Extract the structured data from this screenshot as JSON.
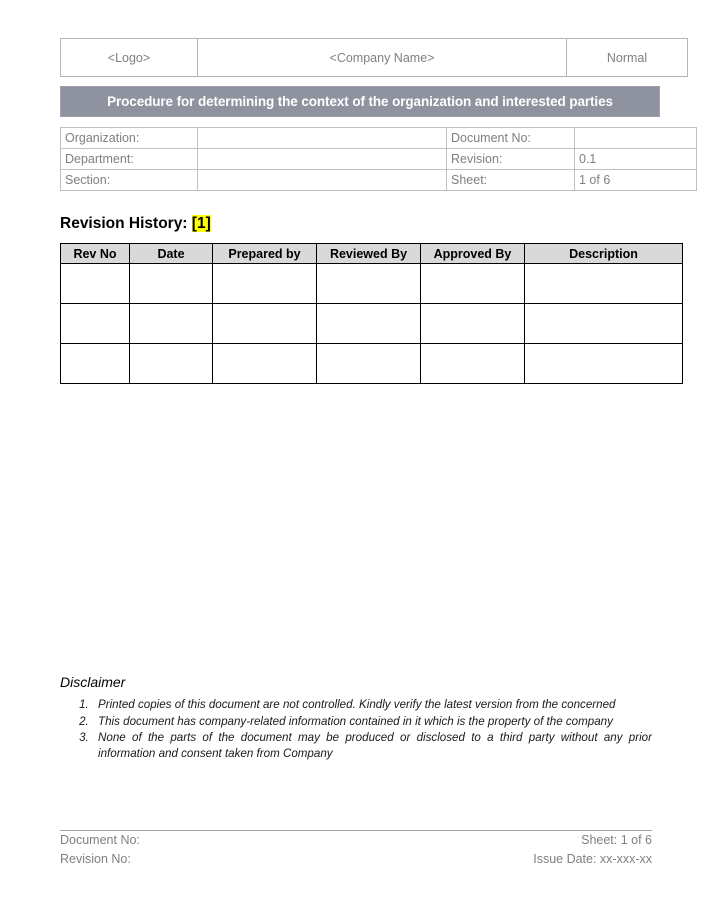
{
  "header": {
    "logo_placeholder": "<Logo>",
    "company_name_placeholder": "<Company Name>",
    "classification": "Normal"
  },
  "title_banner": {
    "text": "Procedure for determining the context of the organization and interested parties",
    "background_color": "#8f939f",
    "text_color": "#ffffff"
  },
  "doc_info": {
    "rows": [
      {
        "left_label": "Organization:",
        "left_value": "",
        "right_label": "Document No:",
        "right_value": ""
      },
      {
        "left_label": "Department:",
        "left_value": "",
        "right_label": "Revision:",
        "right_value": "0.1"
      },
      {
        "left_label": "Section:",
        "left_value": "",
        "right_label": "Sheet:",
        "right_value": "1 of 6"
      }
    ]
  },
  "revision_history": {
    "heading": "Revision History:",
    "heading_marker": "[1]",
    "marker_highlight_color": "#ffff00",
    "columns": [
      "Rev No",
      "Date",
      "Prepared by",
      "Reviewed By",
      "Approved By",
      "Description"
    ],
    "rows": [
      {
        "rev_no": "",
        "date": "",
        "prepared_by": "",
        "reviewed_by": "",
        "approved_by": "",
        "description": ""
      },
      {
        "rev_no": "",
        "date": "",
        "prepared_by": "",
        "reviewed_by": "",
        "approved_by": "",
        "description": ""
      },
      {
        "rev_no": "",
        "date": "",
        "prepared_by": "",
        "reviewed_by": "",
        "approved_by": "",
        "description": ""
      }
    ]
  },
  "disclaimer": {
    "title": "Disclaimer",
    "items": [
      "Printed copies of this document are not controlled. Kindly verify the latest version from the concerned",
      "This document has company-related information contained in it which is the property of the company",
      "None of the parts of the document may be produced or disclosed to a third party without any prior information and consent taken from Company"
    ]
  },
  "footer": {
    "document_no_label": "Document No:",
    "revision_no_label": "Revision No:",
    "sheet": "Sheet: 1 of 6",
    "issue_date": "Issue Date: xx-xxx-xx"
  }
}
